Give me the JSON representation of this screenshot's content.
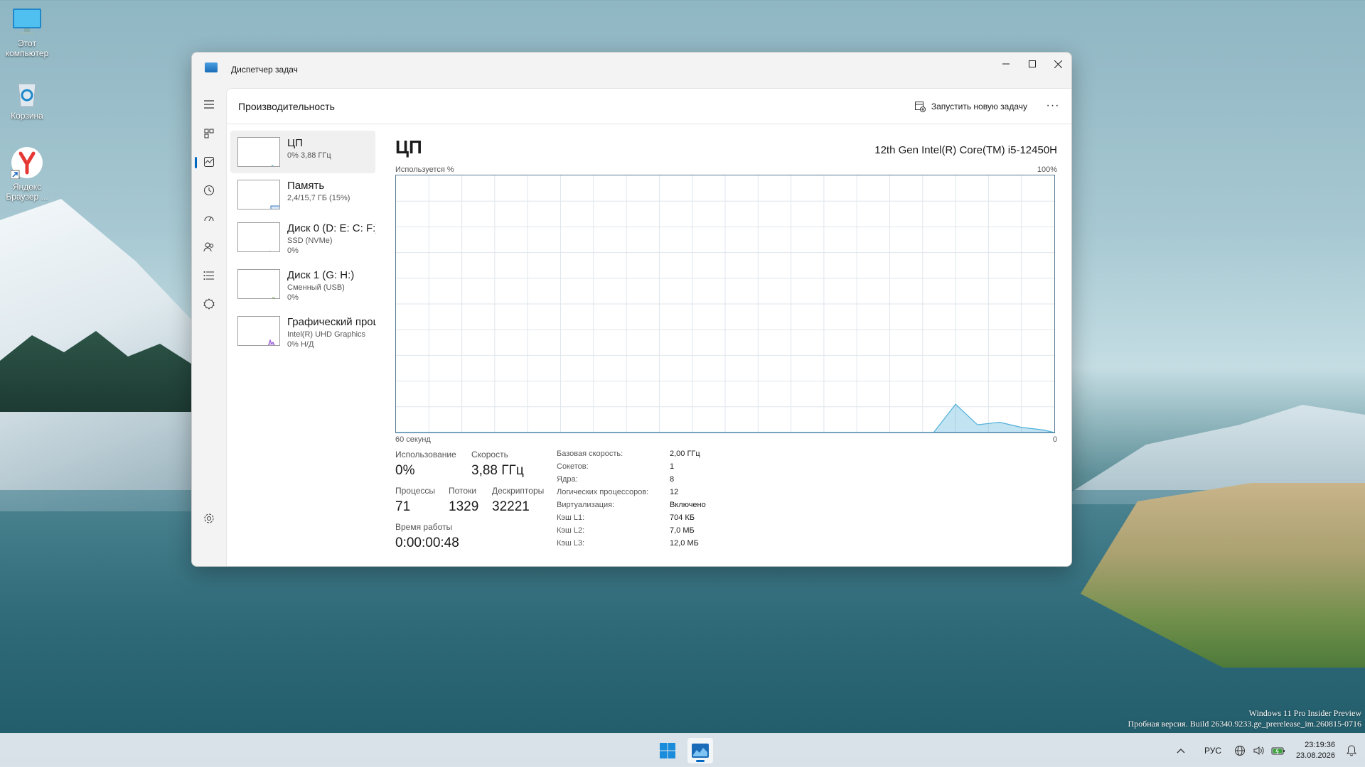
{
  "desktop": {
    "icons": [
      {
        "label": "Этот компьютер"
      },
      {
        "label": "Корзина"
      },
      {
        "label": "Яндекс Браузер ..."
      }
    ],
    "watermark": {
      "line1": "Windows 11 Pro Insider Preview",
      "line2": "Пробная версия. Build 26340.9233.ge_prerelease_im.260815-0716"
    }
  },
  "window": {
    "title": "Диспетчер задач",
    "controls": {
      "minimize": "minimize-icon",
      "maximize": "maximize-icon",
      "close": "close-icon"
    }
  },
  "nav": {
    "items": [
      "hamburger-icon",
      "processes-icon",
      "performance-icon",
      "app-history-icon",
      "startup-icon",
      "users-icon",
      "details-icon",
      "services-icon",
      "settings-icon"
    ],
    "active": "performance-icon"
  },
  "header": {
    "title": "Производительность",
    "run_task": "Запустить новую задачу",
    "more": "···"
  },
  "perf_list": [
    {
      "title": "ЦП",
      "line1": "0%  3,88 ГГц",
      "line2": "",
      "line3": "",
      "selected": true
    },
    {
      "title": "Память",
      "line1": "2,4/15,7 ГБ (15%)",
      "line2": "",
      "line3": ""
    },
    {
      "title": "Диск 0 (D: E: C: F:)",
      "line1": "SSD (NVMe)",
      "line2": "0%",
      "line3": ""
    },
    {
      "title": "Диск 1 (G: H:)",
      "line1": "Сменный (USB)",
      "line2": "0%",
      "line3": ""
    },
    {
      "title": "Графический процессор",
      "line1": "Intel(R) UHD Graphics",
      "line2": "0%  Н/Д",
      "line3": ""
    }
  ],
  "detail": {
    "title": "ЦП",
    "model": "12th Gen Intel(R) Core(TM) i5-12450H",
    "graph_top_left": "Используется %",
    "graph_top_right": "100%",
    "graph_bottom_left": "60 секунд",
    "graph_bottom_right": "0",
    "stats": {
      "usage_label": "Использование",
      "usage_value": "0%",
      "speed_label": "Скорость",
      "speed_value": "3,88 ГГц",
      "processes_label": "Процессы",
      "processes_value": "71",
      "threads_label": "Потоки",
      "threads_value": "1329",
      "handles_label": "Дескрипторы",
      "handles_value": "32221",
      "uptime_label": "Время работы",
      "uptime_value": "0:00:00:48"
    },
    "specs": [
      {
        "k": "Базовая скорость:",
        "v": "2,00 ГГц"
      },
      {
        "k": "Сокетов:",
        "v": "1"
      },
      {
        "k": "Ядра:",
        "v": "8"
      },
      {
        "k": "Логических процессоров:",
        "v": "12"
      },
      {
        "k": "Виртуализация:",
        "v": "Включено"
      },
      {
        "k": "Кэш L1:",
        "v": "704 КБ"
      },
      {
        "k": "Кэш L2:",
        "v": "7,0 МБ"
      },
      {
        "k": "Кэш L3:",
        "v": "12,0 МБ"
      }
    ]
  },
  "chart_data": {
    "type": "area",
    "title": "ЦП",
    "xlabel": "60 секунд",
    "ylabel": "Используется %",
    "xlim": [
      60,
      0
    ],
    "ylim": [
      0,
      100
    ],
    "x": [
      60,
      11,
      9,
      7,
      5,
      3,
      1,
      0
    ],
    "values": [
      0,
      0,
      11,
      3,
      4,
      2,
      1,
      0
    ],
    "grid": true,
    "color": "#4fb0d9"
  },
  "taskbar": {
    "language": "РУС",
    "time": "23:19:36",
    "date": "23.08.2026"
  }
}
